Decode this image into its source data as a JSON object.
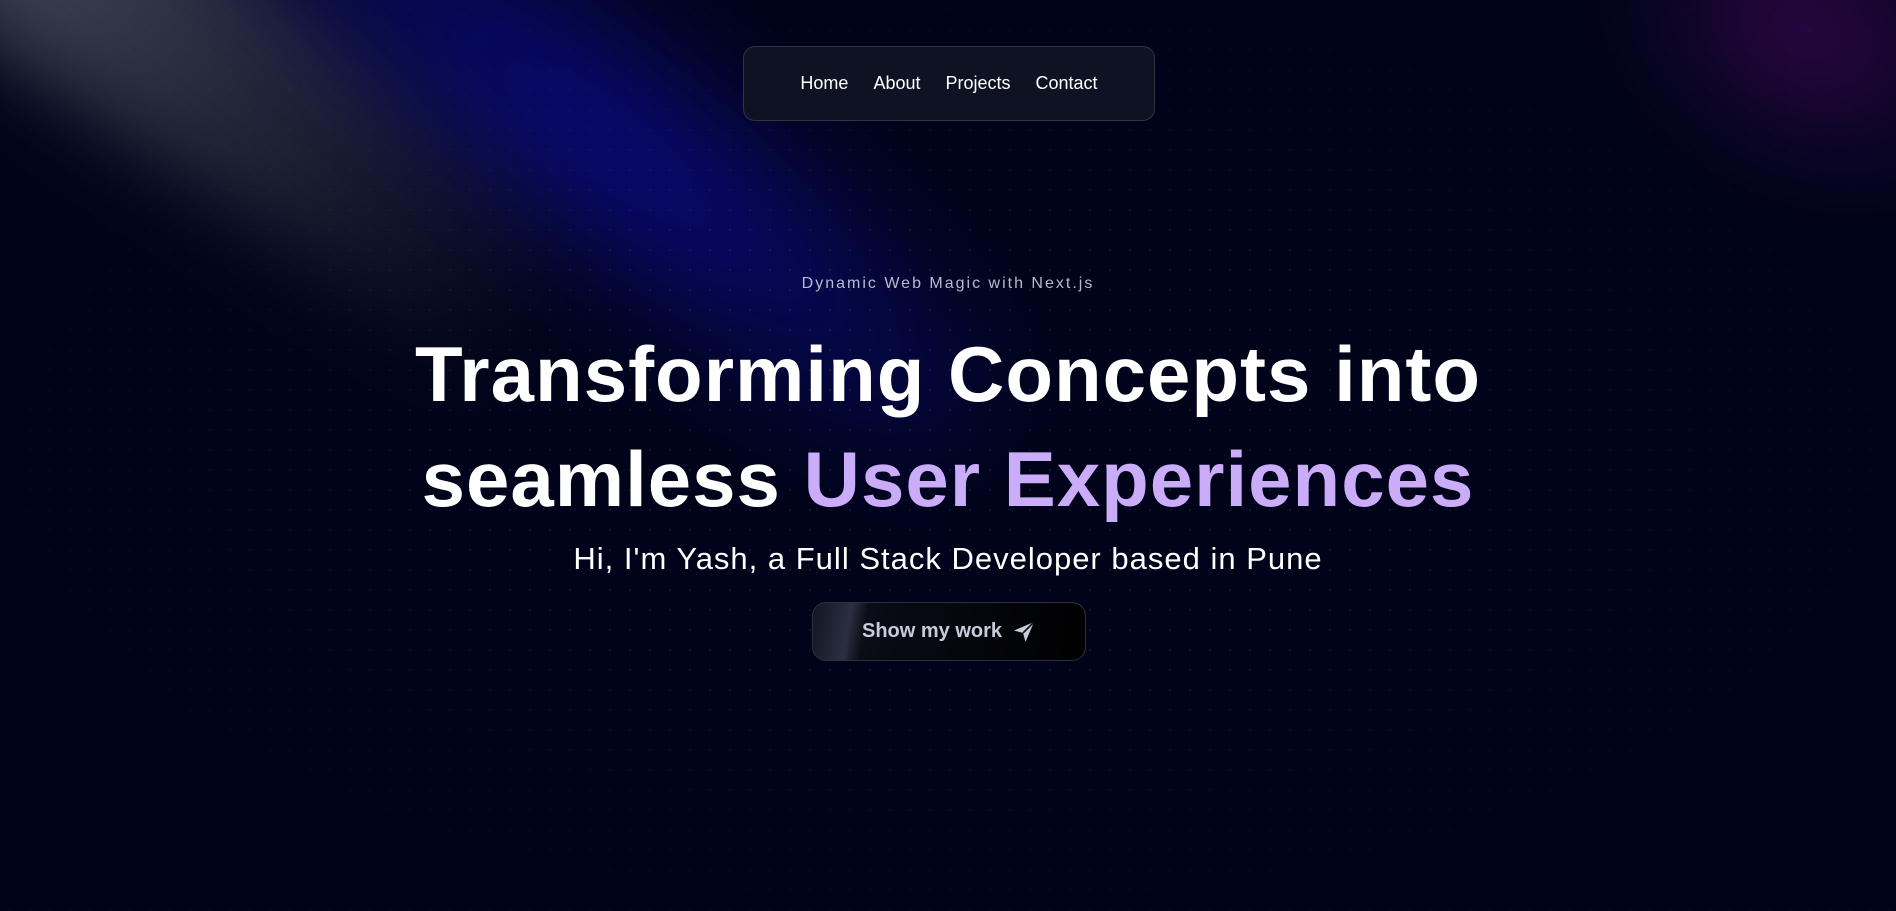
{
  "nav": {
    "items": [
      {
        "label": "Home"
      },
      {
        "label": "About"
      },
      {
        "label": "Projects"
      },
      {
        "label": "Contact"
      }
    ]
  },
  "hero": {
    "eyebrow": "Dynamic Web Magic with Next.js",
    "headline_line1": "Transforming Concepts into",
    "headline_line2_plain": "seamless",
    "headline_line2_accent": "User Experiences",
    "subtitle": "Hi, I'm Yash, a Full Stack Developer based in Pune",
    "cta_label": "Show my work",
    "cta_icon": "send-icon"
  },
  "colors": {
    "background": "#000319",
    "accent": "#cbacf9",
    "nav_background": "#0d1323"
  }
}
